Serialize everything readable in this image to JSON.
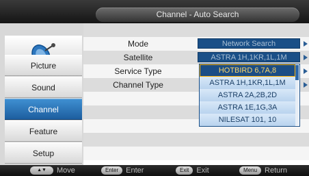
{
  "header": {
    "title": "Channel - Auto Search"
  },
  "sidebar": {
    "icon": "satellite-dish-icon",
    "items": [
      {
        "label": "Picture",
        "active": false
      },
      {
        "label": "Sound",
        "active": false
      },
      {
        "label": "Channel",
        "active": true
      },
      {
        "label": "Feature",
        "active": false
      },
      {
        "label": "Setup",
        "active": false
      }
    ]
  },
  "settings": [
    {
      "label": "Mode",
      "value": "Network Search"
    },
    {
      "label": "Satellite",
      "value": "ASTRA 1H,1KR,1L,1M"
    },
    {
      "label": "Service Type",
      "value": ""
    },
    {
      "label": "Channel Type",
      "value": ""
    }
  ],
  "satellite_dropdown": {
    "selected": "HOTBIRD 6,7A,8",
    "options": [
      "HOTBIRD 6,7A,8",
      "ASTRA 1H,1KR,1L,1M",
      "ASTRA 2A,2B,2D",
      "ASTRA 1E,1G,3A",
      "NILESAT 101, 10"
    ]
  },
  "footer": {
    "move": {
      "key": "▲▼",
      "label": "Move"
    },
    "enter": {
      "key": "Enter",
      "label": "Enter"
    },
    "exit": {
      "key": "Exit",
      "label": "Exit"
    },
    "return": {
      "key": "Menu",
      "label": "Return"
    }
  },
  "colors": {
    "accent": "#1f5e9f",
    "value_box": "#1a4f87",
    "selected_border": "#ffb000"
  }
}
